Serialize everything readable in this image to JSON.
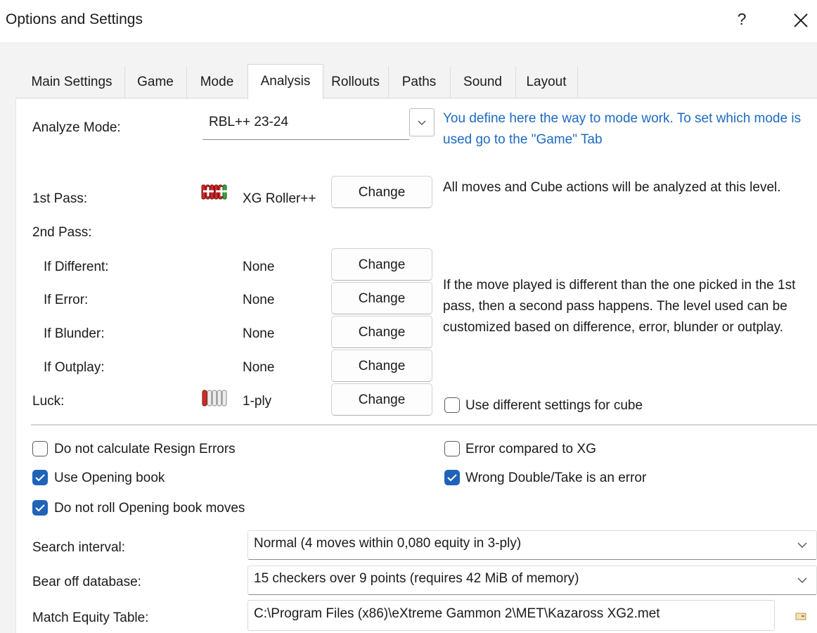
{
  "window": {
    "title": "Options and Settings",
    "help_label": "?",
    "close_icon": "close-icon"
  },
  "tabs": [
    {
      "label": "Main Settings"
    },
    {
      "label": "Game"
    },
    {
      "label": "Mode"
    },
    {
      "label": "Analysis",
      "active": true
    },
    {
      "label": "Rollouts"
    },
    {
      "label": "Paths"
    },
    {
      "label": "Sound"
    },
    {
      "label": "Layout"
    }
  ],
  "analyze_mode": {
    "label": "Analyze Mode:",
    "value": "RBL++ 23-24",
    "hint": "You define here the way to mode work. To set which mode is used go to the \"Game\" Tab"
  },
  "passes": {
    "first_pass": {
      "label": "1st Pass:",
      "value": "XG Roller++",
      "button": "Change",
      "icon": "roller-plus-plus-icon"
    },
    "first_pass_desc": "All moves and Cube actions will be analyzed at this level.",
    "second_pass_label": "2nd Pass:",
    "rows": [
      {
        "label": "If Different:",
        "value": "None",
        "button": "Change"
      },
      {
        "label": "If Error:",
        "value": "None",
        "button": "Change"
      },
      {
        "label": "If Blunder:",
        "value": "None",
        "button": "Change"
      },
      {
        "label": "If Outplay:",
        "value": "None",
        "button": "Change"
      }
    ],
    "second_pass_desc": "If the move played is different than the one picked in the 1st pass, then a second pass happens. The level used can be customized based on difference, error, blunder or outplay.",
    "luck": {
      "label": "Luck:",
      "value": "1-ply",
      "button": "Change",
      "icon": "one-ply-icon"
    },
    "cube_checkbox": {
      "label": "Use different settings for cube",
      "checked": false
    }
  },
  "options": {
    "resign_errors": {
      "label": "Do not calculate Resign Errors",
      "checked": false
    },
    "opening_book": {
      "label": "Use Opening book",
      "checked": true
    },
    "no_roll_opening": {
      "label": "Do not roll Opening book moves",
      "checked": true
    },
    "error_vs_xg": {
      "label": "Error compared to XG",
      "checked": false
    },
    "wrong_double": {
      "label": "Wrong Double/Take is an error",
      "checked": true
    }
  },
  "search_interval": {
    "label": "Search interval:",
    "value": "Normal (4 moves within 0,080 equity in 3-ply)"
  },
  "bear_off": {
    "label": "Bear off database:",
    "value": "15 checkers over 9 points (requires 42 MiB of memory)"
  },
  "met": {
    "label": "Match Equity Table:",
    "value": "C:\\Program Files (x86)\\eXtreme Gammon 2\\MET\\Kazaross XG2.met"
  },
  "colors": {
    "accent": "#1f63b9",
    "hint_text": "#1d6ac2",
    "panel_bg": "#ffffff",
    "window_bg": "#f3f3f3"
  }
}
